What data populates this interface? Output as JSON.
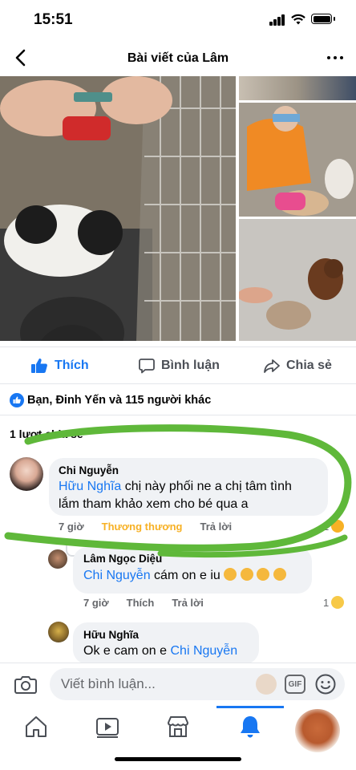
{
  "status_bar": {
    "time": "15:51"
  },
  "header": {
    "title": "Bài viết của Lâm"
  },
  "actions": {
    "like": "Thích",
    "comment": "Bình luận",
    "share": "Chia sẻ"
  },
  "reactions": {
    "summary": "Bạn, Đinh Yến và 115 người khác"
  },
  "shares": {
    "label": "1 lượt chia sẻ"
  },
  "comments": [
    {
      "author": "Chi Nguyễn",
      "mention": "Hữu Nghĩa",
      "text_line1": " chị này phối ne a chị tâm tình",
      "text_line2": "lắm tham khảo xem cho bé qua a",
      "time": "7 giờ",
      "reaction_label": "Thương thương",
      "reply": "Trả lời",
      "reaction_count": "1"
    },
    {
      "author": "Lâm Ngọc Diệu",
      "mention": "Chi Nguyễn",
      "text": " cám on e iu",
      "time": "7 giờ",
      "like": "Thích",
      "reply": "Trả lời",
      "reaction_count": "1"
    },
    {
      "author": "Hữu Nghĩa",
      "text": "Ok e cam on e ",
      "mention": "Chi Nguyễn"
    }
  ],
  "composer": {
    "placeholder": "Viết bình luận...",
    "gif": "GIF"
  },
  "icons": {
    "back": "chevron-left-icon",
    "more": "more-icon",
    "like": "thumbs-up-icon",
    "comment": "speech-bubble-icon",
    "share": "share-arrow-icon",
    "camera": "camera-icon",
    "emoji": "smiley-icon",
    "tabs": [
      "home-icon",
      "video-icon",
      "marketplace-icon",
      "notifications-icon"
    ]
  },
  "colors": {
    "accent": "#1877f2",
    "love": "#f7b125",
    "marker": "#5fb83a"
  }
}
